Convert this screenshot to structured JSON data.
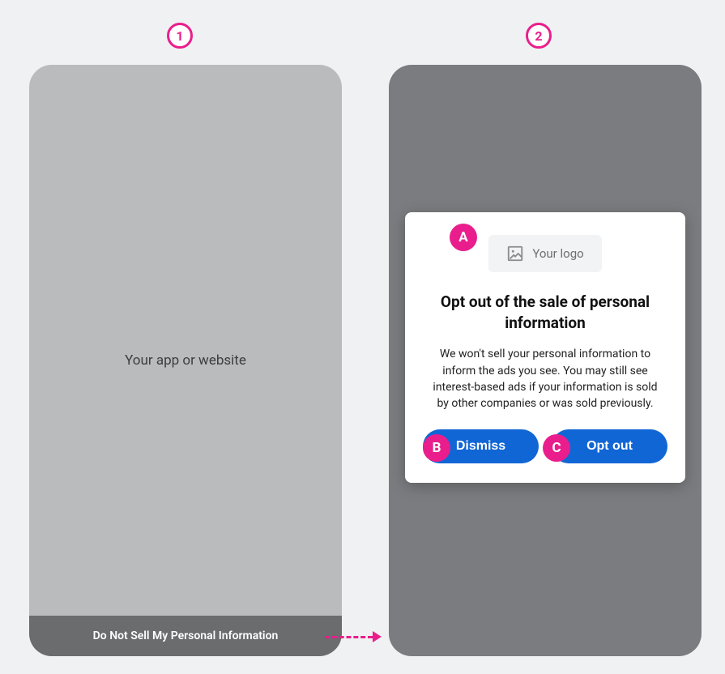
{
  "steps": {
    "one": "1",
    "two": "2"
  },
  "annotations": {
    "a": "A",
    "b": "B",
    "c": "C"
  },
  "screen1": {
    "placeholder": "Your app or website",
    "footer_link": "Do Not Sell My Personal Information"
  },
  "screen2": {
    "logo_placeholder": "Your logo",
    "modal_title": "Opt out of the sale of personal information",
    "modal_body": "We won't sell your personal information to inform the ads you see. You may still see interest-based ads if your information is sold by other companies or was sold previously.",
    "dismiss_label": "Dismiss",
    "optout_label": "Opt out"
  }
}
